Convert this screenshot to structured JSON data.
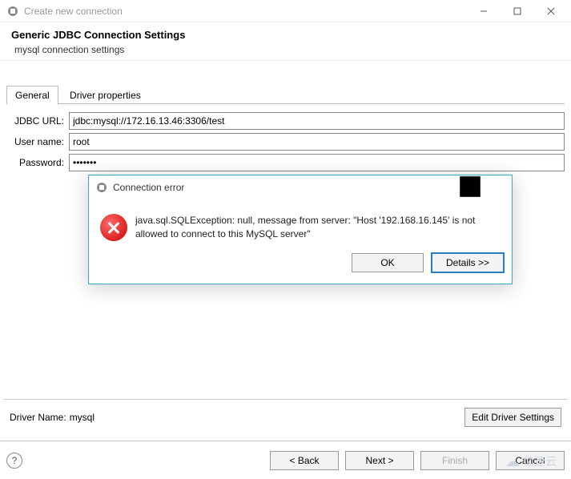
{
  "window": {
    "title": "Create new connection",
    "minimize": "–",
    "maximize": "□",
    "close": "✕"
  },
  "header": {
    "title": "Generic JDBC Connection Settings",
    "subtitle": "mysql connection settings"
  },
  "tabs": {
    "general": "General",
    "driver_props": "Driver properties"
  },
  "form": {
    "jdbc_label": "JDBC URL:",
    "jdbc_value": "jdbc:mysql://172.16.13.46:3306/test",
    "user_label": "User name:",
    "user_value": "root",
    "pass_label": "Password:",
    "pass_value": "1234567"
  },
  "driver": {
    "label": "Driver Name:",
    "value": "mysql",
    "edit_btn": "Edit Driver Settings"
  },
  "footer": {
    "help": "?",
    "back": "< Back",
    "next": "Next >",
    "finish": "Finish",
    "cancel": "Cancel"
  },
  "modal": {
    "title": "Connection error",
    "message": "java.sql.SQLException: null,  message from server: \"Host '192.168.16.145' is not allowed to connect to this MySQL server\"",
    "ok": "OK",
    "details": "Details >>"
  },
  "watermark": "亿速云"
}
